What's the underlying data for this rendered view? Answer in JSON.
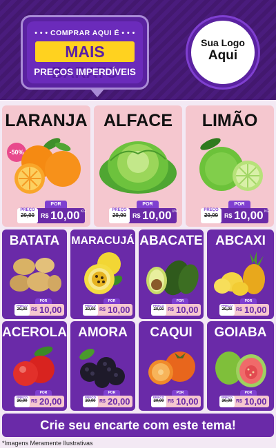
{
  "banner": {
    "top": "• • • COMPRAR AQUI É • • •",
    "main": "MAIS BARATO",
    "sub": "PREÇOS IMPERDÍVEIS"
  },
  "logo": {
    "line1": "Sua Logo",
    "line2": "Aqui"
  },
  "badge": "-50%",
  "labels": {
    "old": "PREÇO",
    "new": "POR",
    "currency": "R$"
  },
  "products_row1": [
    {
      "name": "LARANJA",
      "old": "20,00",
      "price": "10,00",
      "unit": "KG"
    },
    {
      "name": "ALFACE",
      "old": "20,00",
      "price": "10,00",
      "unit": "UNI"
    },
    {
      "name": "LIMÃO",
      "old": "20,00",
      "price": "10,00",
      "unit": "KG"
    }
  ],
  "products_row2": [
    {
      "name": "BATATA",
      "old": "20,00",
      "price": "10,00"
    },
    {
      "name": "MARACUJÁ",
      "old": "20,00",
      "price": "10,00"
    },
    {
      "name": "ABACATE",
      "old": "20,00",
      "price": "10,00"
    },
    {
      "name": "ABCAXI",
      "old": "20,00",
      "price": "10,00"
    }
  ],
  "products_row3": [
    {
      "name": "ACEROLA",
      "old": "20,00",
      "price": "20,00"
    },
    {
      "name": "AMORA",
      "old": "20,00",
      "price": "20,00"
    },
    {
      "name": "CAQUI",
      "old": "20,00",
      "price": "10,00"
    },
    {
      "name": "GOIABA",
      "old": "20,00",
      "price": "10,00"
    }
  ],
  "cta": "Crie seu encarte com este tema!",
  "footnote": "*Imagens Meramente Ilustrativas",
  "colors": {
    "purple": "#6a2aa8",
    "pink": "#f5c7cf",
    "yellow": "#ffd21f"
  }
}
